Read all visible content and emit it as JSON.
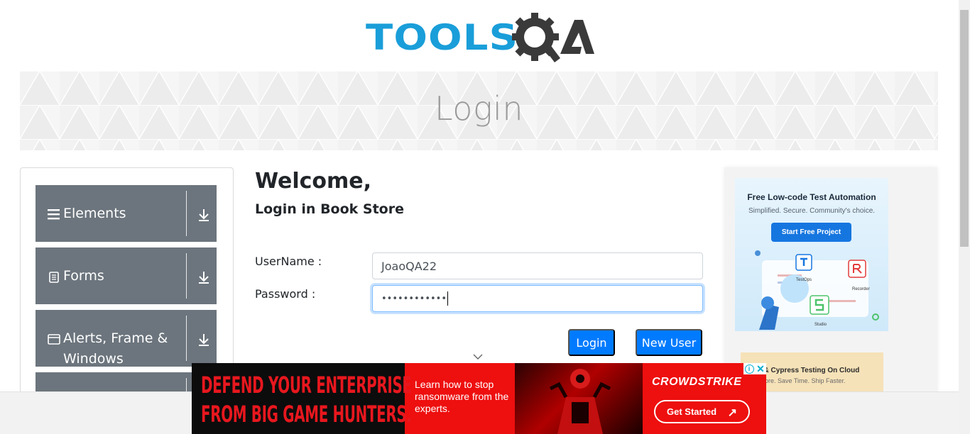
{
  "header": {
    "logo_tools": "TOOLS",
    "logo_qa": "QA"
  },
  "banner": {
    "title": "Login"
  },
  "sidebar": {
    "groups": [
      {
        "label": "Elements",
        "icon": "hamburger-icon"
      },
      {
        "label": "Forms",
        "icon": "document-icon"
      },
      {
        "label": "Alerts, Frame & Windows",
        "icon": "window-icon"
      }
    ]
  },
  "main": {
    "welcome": "Welcome,",
    "subtitle": "Login in Book Store",
    "username_label": "UserName :",
    "username_value": "JoaoQA22",
    "password_label": "Password :",
    "password_value": "••••••••••••",
    "login_button": "Login",
    "new_user_button": "New User"
  },
  "ad_right": {
    "title": "Free Low-code Test Automation",
    "subtitle": "Simplified. Secure. Community's choice.",
    "cta": "Start Free Project",
    "labels": [
      "TestOps",
      "Recorder",
      "Studio"
    ],
    "ad2_title": "ium & Cypress Testing On Cloud",
    "ad2_sub": "est More. Save Time. Ship Faster."
  },
  "ad_bottom": {
    "headline_1": "DEFEND YOUR ENTERPRISE",
    "headline_2": "FROM BIG GAME HUNTERS.",
    "body": "Learn how to stop ransomware from the experts.",
    "brand": "CROWDSTRIKE",
    "cta": "Get Started"
  },
  "colors": {
    "primary": "#007bff",
    "sidebar_group": "#6c757d",
    "logo_blue": "#1a9ed9",
    "logo_dark": "#3a3a3a",
    "ad_red": "#ee0f0f"
  }
}
